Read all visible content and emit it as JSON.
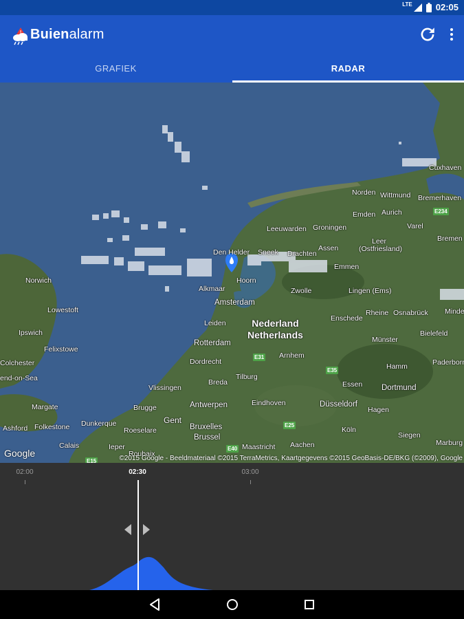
{
  "status": {
    "network": "LTE",
    "time": "02:05"
  },
  "app": {
    "title_bold": "Buien",
    "title_rest": "alarm"
  },
  "tabs": [
    {
      "label": "GRAFIEK",
      "active": false
    },
    {
      "label": "RADAR",
      "active": true
    }
  ],
  "map": {
    "places": {
      "norden": "Norden",
      "wittmund": "Wittmund",
      "bremerhaven": "Bremerhaven",
      "cuxhaven": "Cuxhaven",
      "emden": "Emden",
      "aurich": "Aurich",
      "varel": "Varel",
      "bremen": "Bremen",
      "leeuwarden": "Leeuwarden",
      "groningen": "Groningen",
      "leer": "Leer",
      "leer_sub": "(Ostfriesland)",
      "den_helder": "Den Helder",
      "sneek": "Sneek",
      "assen": "Assen",
      "drachten": "Drachten",
      "hoorn": "Hoorn",
      "emmen": "Emmen",
      "norwich": "Norwich",
      "lowestoft": "Lowestoft",
      "alkmaar": "Alkmaar",
      "zwolle": "Zwolle",
      "lingen": "Lingen (Ems)",
      "amsterdam": "Amsterdam",
      "leiden": "Leiden",
      "enschede": "Enschede",
      "rheine": "Rheine",
      "osnabruck": "Osnabrück",
      "minden": "Minde",
      "ipswich": "Ipswich",
      "nederland": "Nederland",
      "netherlands": "Netherlands",
      "felixstowe": "Felixstowe",
      "rotterdam": "Rotterdam",
      "munster": "Münster",
      "bielefeld": "Bielefeld",
      "colchester": "Colchester",
      "dordrecht": "Dordrecht",
      "arnhem": "Arnhem",
      "paderborn": "Paderborn",
      "southend": "end-on-Sea",
      "breda": "Breda",
      "tilburg": "Tilburg",
      "hamm": "Hamm",
      "vlissingen": "Vlissingen",
      "essen": "Essen",
      "dortmund": "Dortmund",
      "margate": "Margate",
      "brugge": "Brugge",
      "antwerpen": "Antwerpen",
      "eindhoven": "Eindhoven",
      "dusseldorf": "Düsseldorf",
      "ashford": "Ashford",
      "folkestone": "Folkestone",
      "dunkerque": "Dunkerque",
      "gent": "Gent",
      "roeselare": "Roeselare",
      "bruxelles": "Bruxelles",
      "brussel": "Brussel",
      "hagen": "Hagen",
      "calais": "Calais",
      "koln": "Köln",
      "siegen": "Siegen",
      "maastricht": "Maastricht",
      "aachen": "Aachen",
      "ieper": "Ieper",
      "roubaix": "Roubaix",
      "marburg": "Marburg"
    },
    "roads": {
      "e234": "E234",
      "e31": "E31",
      "e35": "E35",
      "e25": "E25",
      "e40": "E40",
      "e15": "E15"
    },
    "google_logo": "Google",
    "attribution": "©2015 Google - Beeldmateriaal ©2015 TerraMetrics, Kaartgegevens ©2015 GeoBasis-DE/BKG (©2009), Google"
  },
  "timeline": {
    "ticks": [
      {
        "label": "02:00"
      },
      {
        "label": "02:30",
        "current": true
      },
      {
        "label": "03:00"
      }
    ]
  },
  "colors": {
    "statusbar": "#0d47a1",
    "appbar": "#1e56c6",
    "sea": "#3a5d8c",
    "land": "#4e6a3e",
    "rain": "#2563eb",
    "timeline_bg": "#313131"
  },
  "icons": [
    "logo-cloud-icon",
    "refresh-icon",
    "overflow-menu-icon",
    "location-pin-icon",
    "back-icon",
    "home-icon",
    "recents-icon"
  ]
}
